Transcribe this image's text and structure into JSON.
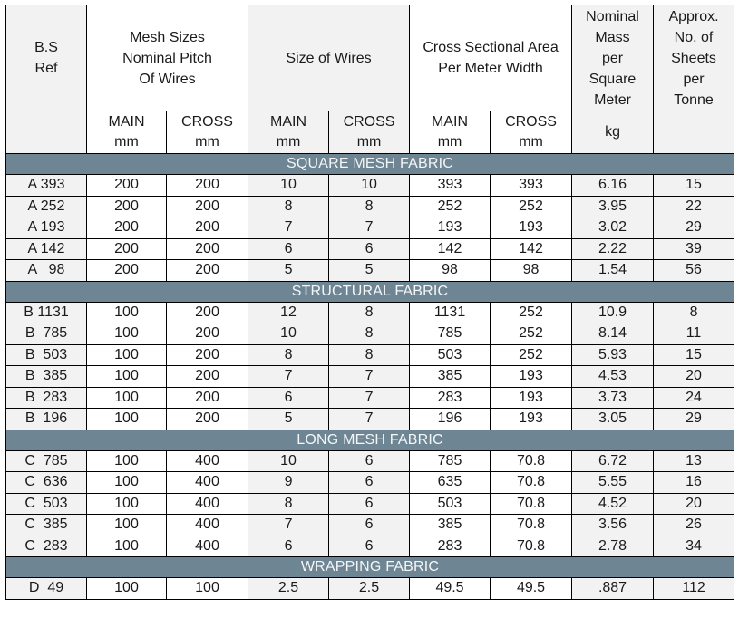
{
  "header": {
    "bs_ref": "B.S\nRef",
    "mesh_sizes": "Mesh Sizes\nNominal Pitch\nOf Wires",
    "size_of_wires": "Size of Wires",
    "cross_sectional_area": "Cross Sectional Area\nPer Meter Width",
    "nominal_mass": "Nominal\nMass\nper\nSquare\nMeter",
    "approx_sheets": "Approx.\nNo. of\nSheets\nper\nTonne",
    "sub": {
      "main_mm": "MAIN\nmm",
      "cross_mm": "CROSS\nmm",
      "kg": "kg",
      "blank": ""
    }
  },
  "sections": [
    {
      "title": "SQUARE MESH FABRIC",
      "rows": [
        [
          "A 393",
          "200",
          "200",
          "10",
          "10",
          "393",
          "393",
          "6.16",
          "15"
        ],
        [
          "A 252",
          "200",
          "200",
          "8",
          "8",
          "252",
          "252",
          "3.95",
          "22"
        ],
        [
          "A 193",
          "200",
          "200",
          "7",
          "7",
          "193",
          "193",
          "3.02",
          "29"
        ],
        [
          "A 142",
          "200",
          "200",
          "6",
          "6",
          "142",
          "142",
          "2.22",
          "39"
        ],
        [
          "A   98",
          "200",
          "200",
          "5",
          "5",
          "98",
          "98",
          "1.54",
          "56"
        ]
      ]
    },
    {
      "title": "STRUCTURAL FABRIC",
      "rows": [
        [
          "B 1131",
          "100",
          "200",
          "12",
          "8",
          "1131",
          "252",
          "10.9",
          "8"
        ],
        [
          "B  785",
          "100",
          "200",
          "10",
          "8",
          "785",
          "252",
          "8.14",
          "11"
        ],
        [
          "B  503",
          "100",
          "200",
          "8",
          "8",
          "503",
          "252",
          "5.93",
          "15"
        ],
        [
          "B  385",
          "100",
          "200",
          "7",
          "7",
          "385",
          "193",
          "4.53",
          "20"
        ],
        [
          "B  283",
          "100",
          "200",
          "6",
          "7",
          "283",
          "193",
          "3.73",
          "24"
        ],
        [
          "B  196",
          "100",
          "200",
          "5",
          "7",
          "196",
          "193",
          "3.05",
          "29"
        ]
      ]
    },
    {
      "title": "LONG MESH FABRIC",
      "rows": [
        [
          "C  785",
          "100",
          "400",
          "10",
          "6",
          "785",
          "70.8",
          "6.72",
          "13"
        ],
        [
          "C  636",
          "100",
          "400",
          "9",
          "6",
          "635",
          "70.8",
          "5.55",
          "16"
        ],
        [
          "C  503",
          "100",
          "400",
          "8",
          "6",
          "503",
          "70.8",
          "4.52",
          "20"
        ],
        [
          "C  385",
          "100",
          "400",
          "7",
          "6",
          "385",
          "70.8",
          "3.56",
          "26"
        ],
        [
          "C  283",
          "100",
          "400",
          "6",
          "6",
          "283",
          "70.8",
          "2.78",
          "34"
        ]
      ]
    },
    {
      "title": "WRAPPING FABRIC",
      "rows": [
        [
          "D  49",
          "100",
          "100",
          "2.5",
          "2.5",
          "49.5",
          "49.5",
          ".887",
          "112"
        ]
      ]
    }
  ],
  "colors": {
    "section_band": "#6e8594",
    "shaded_cell": "#f2f2f2"
  }
}
